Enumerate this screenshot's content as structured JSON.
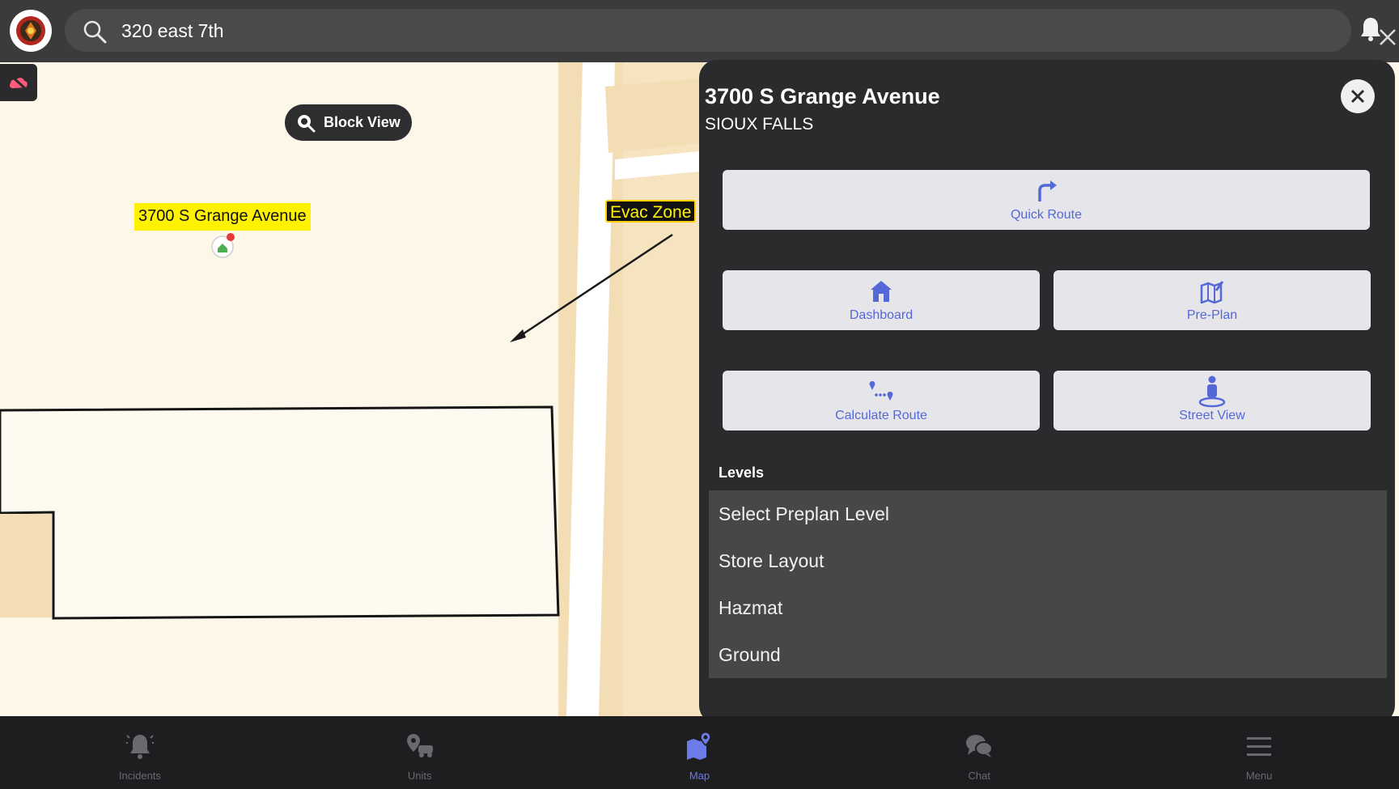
{
  "header": {
    "search": {
      "value": "320 east 7th",
      "placeholder": "Search"
    },
    "icons": [
      "logo",
      "search-icon",
      "close-icon",
      "bell-icon"
    ]
  },
  "map": {
    "block_view_label": "Block View",
    "address_label": "3700 S Grange Avenue",
    "evac_label": "Evac Zone",
    "colors": {
      "map_bg": "#fdf7ea",
      "road": "#f3ddb5",
      "label_highlight": "#fff200"
    }
  },
  "panel": {
    "title": "3700 S Grange Avenue",
    "subtitle": "SIOUX FALLS",
    "actions": {
      "quick_route": "Quick Route",
      "dashboard": "Dashboard",
      "pre_plan": "Pre-Plan",
      "calculate_route": "Calculate Route",
      "street_view": "Street View"
    },
    "levels_title": "Levels",
    "levels": [
      "Select Preplan Level",
      "Store Layout",
      "Hazmat",
      "Ground"
    ],
    "accent_color": "#5468d8"
  },
  "nav": {
    "items": [
      {
        "label": "Incidents",
        "icon": "bell-alert-icon"
      },
      {
        "label": "Units",
        "icon": "units-icon"
      },
      {
        "label": "Map",
        "icon": "map-icon",
        "active": true
      },
      {
        "label": "Chat",
        "icon": "chat-icon"
      },
      {
        "label": "Menu",
        "icon": "hamburger-icon"
      }
    ]
  }
}
